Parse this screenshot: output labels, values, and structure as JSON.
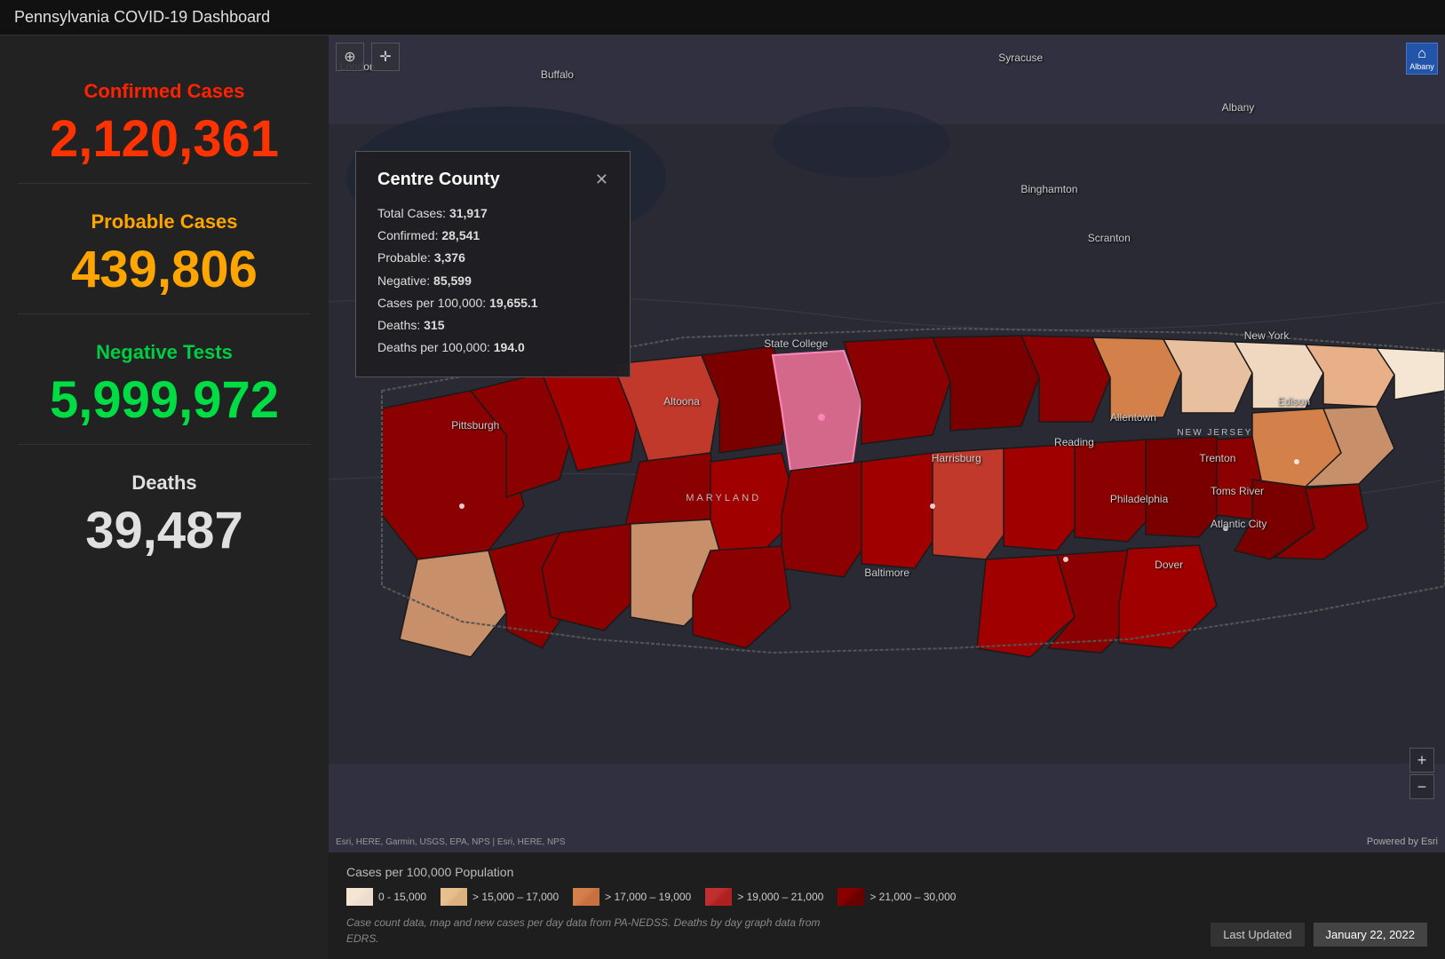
{
  "title": "Pennsylvania COVID-19 Dashboard",
  "sidebar": {
    "confirmed_label": "Confirmed Cases",
    "confirmed_value": "2,120,361",
    "probable_label": "Probable Cases",
    "probable_value": "439,806",
    "negative_label": "Negative Tests",
    "negative_value": "5,999,972",
    "deaths_label": "Deaths",
    "deaths_value": "39,487"
  },
  "tooltip": {
    "county": "Centre County",
    "close_symbol": "✕",
    "fields": [
      {
        "label": "Total Cases:",
        "value": "31,917"
      },
      {
        "label": "Confirmed:",
        "value": "28,541"
      },
      {
        "label": "Probable:",
        "value": "3,376"
      },
      {
        "label": "Negative:",
        "value": "85,599"
      },
      {
        "label": "Cases per 100,000:",
        "value": "19,655.1"
      },
      {
        "label": "Deaths:",
        "value": "315"
      },
      {
        "label": "Deaths per 100,000:",
        "value": "194.0"
      }
    ]
  },
  "map_controls": {
    "zoom_in_icon": "⊕",
    "pan_icon": "✛",
    "home_icon": "⌂",
    "home_label": "Albany",
    "zoom_plus": "+",
    "zoom_minus": "−"
  },
  "attribution": {
    "esri": "Esri, HERE, Garmin, USGS, EPA, NPS | Esri, HERE, NPS",
    "powered": "Powered by Esri"
  },
  "legend": {
    "title": "Cases per 100,000 Population",
    "items": [
      {
        "color": "#f5e6d3",
        "label": "0 - 15,000"
      },
      {
        "color": "#e8b88a",
        "label": "> 15,000 – 17,000"
      },
      {
        "color": "#d4804a",
        "label": "> 17,000 – 19,000"
      },
      {
        "color": "#b83030",
        "label": "> 19,000 – 21,000"
      },
      {
        "color": "#7a0000",
        "label": "> 21,000 – 30,000"
      }
    ],
    "note": "Case count data, map and new cases per day data from PA-NEDSS.  Deaths by day graph data from EDRS.",
    "last_updated_label": "Last Updated",
    "last_updated_value": "January 22, 2022"
  },
  "map_cities": [
    {
      "name": "London",
      "top": "4%",
      "left": "3%"
    },
    {
      "name": "Buffalo",
      "top": "5%",
      "left": "22%"
    },
    {
      "name": "Syracuse",
      "top": "2%",
      "left": "62%"
    },
    {
      "name": "Albany",
      "top": "8%",
      "left": "84%"
    },
    {
      "name": "Binghamton",
      "top": "18%",
      "left": "67%"
    },
    {
      "name": "Scranton",
      "top": "24%",
      "left": "73%"
    },
    {
      "name": "Allentown",
      "top": "46%",
      "left": "74%"
    },
    {
      "name": "New York",
      "top": "38%",
      "left": "84%"
    },
    {
      "name": "Edison",
      "top": "46%",
      "left": "87%"
    },
    {
      "name": "Trenton",
      "top": "52%",
      "left": "80%"
    },
    {
      "name": "Philadelphia",
      "top": "57%",
      "left": "74%"
    },
    {
      "name": "Toms River",
      "top": "56%",
      "left": "83%"
    },
    {
      "name": "NEW JERSEY",
      "top": "48%",
      "left": "78%"
    },
    {
      "name": "Pittsburgh",
      "top": "48%",
      "left": "17%"
    },
    {
      "name": "Altoona",
      "top": "46%",
      "left": "36%"
    },
    {
      "name": "State College",
      "top": "38%",
      "left": "42%"
    },
    {
      "name": "Harrisburg",
      "top": "52%",
      "left": "58%"
    },
    {
      "name": "Reading",
      "top": "50%",
      "left": "68%"
    },
    {
      "name": "Baltimore",
      "top": "68%",
      "left": "52%"
    },
    {
      "name": "Atlantic City",
      "top": "60%",
      "left": "82%"
    },
    {
      "name": "Dover",
      "top": "66%",
      "left": "77%"
    }
  ]
}
